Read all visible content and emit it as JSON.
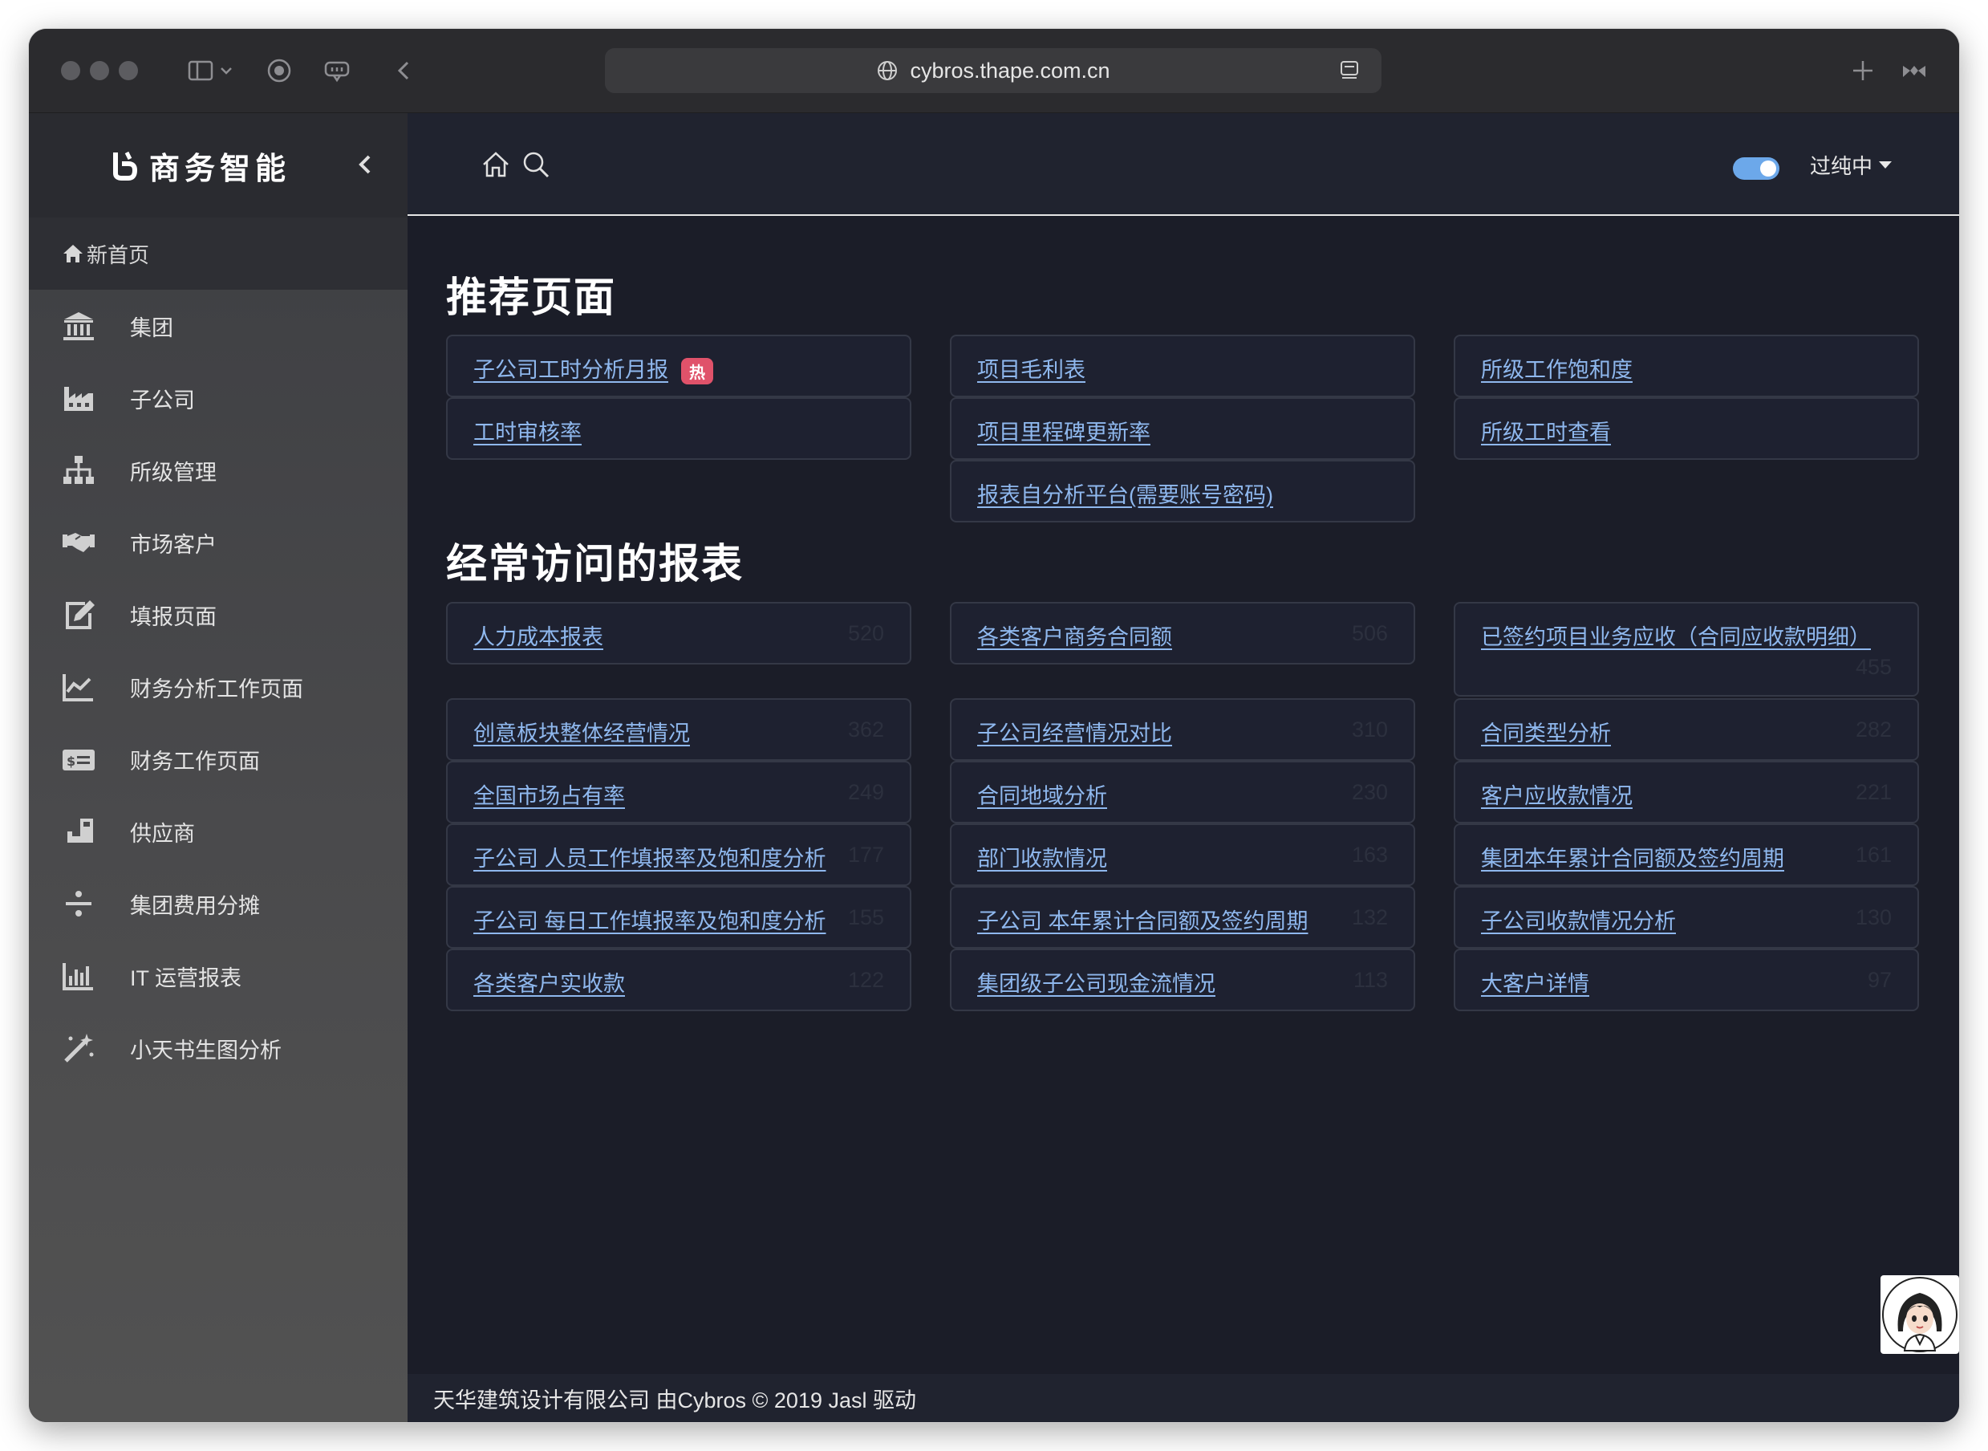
{
  "browser": {
    "url": "cybros.thape.com.cn"
  },
  "sidebar": {
    "brand": "商务智能",
    "home": "新首页",
    "items": [
      {
        "label": "集团",
        "icon": "bank-icon"
      },
      {
        "label": "子公司",
        "icon": "factory-icon"
      },
      {
        "label": "所级管理",
        "icon": "sitemap-icon"
      },
      {
        "label": "市场客户",
        "icon": "handshake-icon"
      },
      {
        "label": "填报页面",
        "icon": "edit-icon"
      },
      {
        "label": "财务分析工作页面",
        "icon": "line-chart-icon"
      },
      {
        "label": "财务工作页面",
        "icon": "money-card-icon"
      },
      {
        "label": "供应商",
        "icon": "supplier-icon"
      },
      {
        "label": "集团费用分摊",
        "icon": "divide-icon"
      },
      {
        "label": "IT 运营报表",
        "icon": "bar-chart-icon"
      },
      {
        "label": "小天书生图分析",
        "icon": "magic-wand-icon"
      }
    ]
  },
  "topbar": {
    "user": "过纯中"
  },
  "recommended": {
    "title": "推荐页面",
    "hot_badge": "热",
    "items": [
      {
        "label": "子公司工时分析月报",
        "hot": true
      },
      {
        "label": "工时审核率"
      },
      {
        "label": "项目毛利表"
      },
      {
        "label": "项目里程碑更新率"
      },
      {
        "label": "报表自分析平台(需要账号密码)"
      },
      {
        "label": "所级工作饱和度"
      },
      {
        "label": "所级工时查看"
      }
    ]
  },
  "frequent": {
    "title": "经常访问的报表",
    "items": [
      {
        "label": "人力成本报表",
        "count": "520"
      },
      {
        "label": "各类客户商务合同额",
        "count": "506"
      },
      {
        "label": "已签约项目业务应收（合同应收款明细）",
        "count": "455"
      },
      {
        "label": "创意板块整体经营情况",
        "count": "362"
      },
      {
        "label": "子公司经营情况对比",
        "count": "310"
      },
      {
        "label": "合同类型分析",
        "count": "282"
      },
      {
        "label": "全国市场占有率",
        "count": "249"
      },
      {
        "label": "合同地域分析",
        "count": "230"
      },
      {
        "label": "客户应收款情况",
        "count": "221"
      },
      {
        "label": "子公司 人员工作填报率及饱和度分析",
        "count": "177"
      },
      {
        "label": "部门收款情况",
        "count": "163"
      },
      {
        "label": "集团本年累计合同额及签约周期",
        "count": "161"
      },
      {
        "label": "子公司 每日工作填报率及饱和度分析",
        "count": "155"
      },
      {
        "label": "子公司 本年累计合同额及签约周期",
        "count": "132"
      },
      {
        "label": "子公司收款情况分析",
        "count": "130"
      },
      {
        "label": "各类客户实收款",
        "count": "122"
      },
      {
        "label": "集团级子公司现金流情况",
        "count": "113"
      },
      {
        "label": "大客户详情",
        "count": "97"
      }
    ]
  },
  "footer": {
    "text": "天华建筑设计有限公司 由Cybros © 2019 Jasl 驱动"
  }
}
